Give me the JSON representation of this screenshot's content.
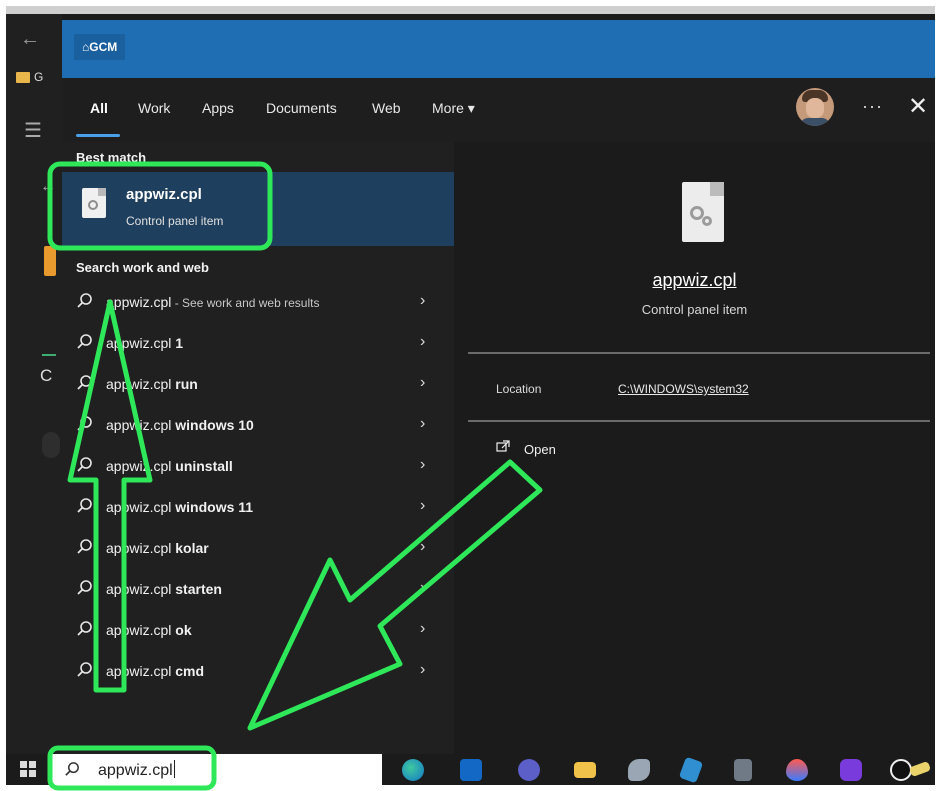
{
  "banner": {
    "logo": "⌂GCM"
  },
  "tabs": [
    {
      "label": "All",
      "active": true
    },
    {
      "label": "Work"
    },
    {
      "label": "Apps"
    },
    {
      "label": "Documents"
    },
    {
      "label": "Web"
    },
    {
      "label": "More ▾"
    }
  ],
  "header_icons": {
    "avatar": "user-avatar",
    "more": "more-dots-icon",
    "close": "close-icon"
  },
  "best_match": {
    "heading": "Best match",
    "title": "appwiz.cpl",
    "subtitle": "Control panel item"
  },
  "search_section": {
    "heading": "Search work and web",
    "items": [
      {
        "base": "appwiz.cpl",
        "bold": "",
        "hint": " - See work and web results"
      },
      {
        "base": "appwiz.cpl",
        "bold": " 1",
        "hint": ""
      },
      {
        "base": "appwiz.cpl",
        "bold": " run",
        "hint": ""
      },
      {
        "base": "appwiz.cpl",
        "bold": " windows 10",
        "hint": ""
      },
      {
        "base": "appwiz.cpl",
        "bold": " uninstall",
        "hint": ""
      },
      {
        "base": "appwiz.cpl",
        "bold": " windows 11",
        "hint": ""
      },
      {
        "base": "appwiz.cpl",
        "bold": " kolar",
        "hint": ""
      },
      {
        "base": "appwiz.cpl",
        "bold": " starten",
        "hint": ""
      },
      {
        "base": "appwiz.cpl",
        "bold": " ok",
        "hint": ""
      },
      {
        "base": "appwiz.cpl",
        "bold": " cmd",
        "hint": ""
      }
    ]
  },
  "detail": {
    "title": "appwiz.cpl",
    "subtitle": "Control panel item",
    "location_label": "Location",
    "location_value": "C:\\WINDOWS\\system32",
    "open_label": "Open"
  },
  "taskbar": {
    "search_value": "appwiz.cpl",
    "icons": [
      "edge-icon",
      "outlook-icon",
      "teams-icon",
      "file-explorer-icon",
      "paint-icon",
      "snipping-icon",
      "calculator-icon",
      "ink-drop-icon",
      "purple-app-icon",
      "g-app-icon",
      "eraser-icon"
    ]
  },
  "colors": {
    "banner": "#1f6db3",
    "highlight": "#1f3f5e",
    "annotation": "#2ee85a"
  }
}
